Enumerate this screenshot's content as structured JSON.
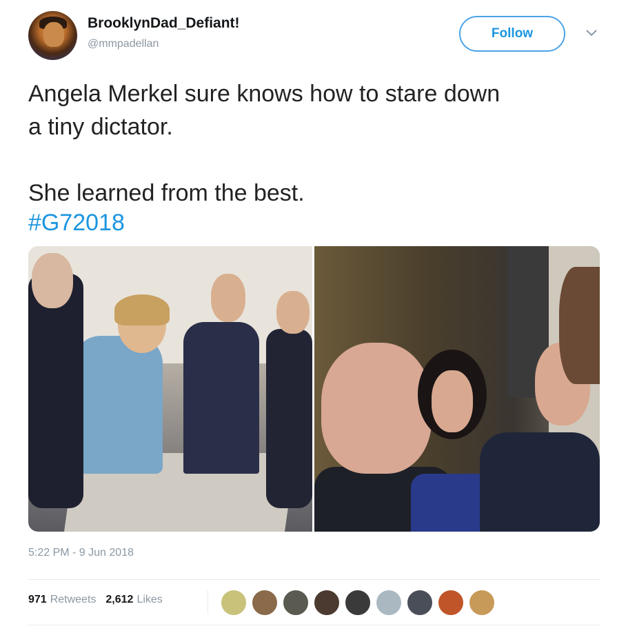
{
  "user": {
    "display_name": "BrooklynDad_Defiant!",
    "handle": "@mmpadellan"
  },
  "follow_label": "Follow",
  "tweet": {
    "text": "Angela Merkel sure knows how to stare down\na tiny dictator.\n\nShe learned from the best.",
    "hashtag": "#G72018"
  },
  "timestamp": "5:22 PM - 9 Jun 2018",
  "stats": {
    "retweets_count": "971",
    "retweets_label": "Retweets",
    "likes_count": "2,612",
    "likes_label": "Likes"
  },
  "likers": [
    {
      "name": "liker-avatar-1",
      "color": "#c8c27a"
    },
    {
      "name": "liker-avatar-2",
      "color": "#8a6a4a"
    },
    {
      "name": "liker-avatar-3",
      "color": "#5a5a50"
    },
    {
      "name": "liker-avatar-4",
      "color": "#4a3a30"
    },
    {
      "name": "liker-avatar-5",
      "color": "#3a3a3a"
    },
    {
      "name": "liker-avatar-6",
      "color": "#aab8c2"
    },
    {
      "name": "liker-avatar-7",
      "color": "#4a4e58"
    },
    {
      "name": "liker-avatar-8",
      "color": "#c0552a"
    },
    {
      "name": "liker-avatar-9",
      "color": "#c89a5a"
    }
  ],
  "colors": {
    "accent": "#1b95e0",
    "muted": "#8a97a3"
  }
}
